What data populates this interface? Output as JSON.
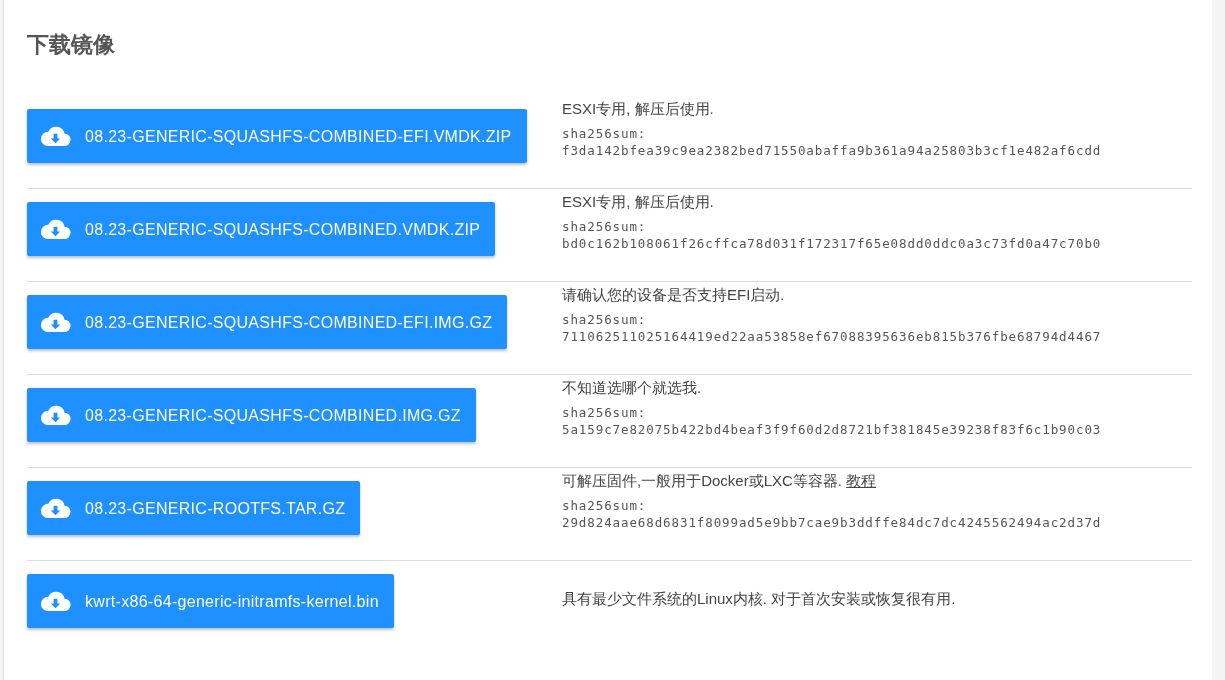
{
  "title": "下载镜像",
  "downloads": [
    {
      "file": "08.23-GENERIC-SQUASHFS-COMBINED-EFI.VMDK.ZIP",
      "description": "ESXI专用, 解压后使用.",
      "sha_label": "sha256sum:",
      "sha": "f3da142bfea39c9ea2382bed71550abaffa9b361a94a25803b3cf1e482af6cdd"
    },
    {
      "file": "08.23-GENERIC-SQUASHFS-COMBINED.VMDK.ZIP",
      "description": "ESXI专用, 解压后使用.",
      "sha_label": "sha256sum:",
      "sha": "bd0c162b108061f26cffca78d031f172317f65e08dd0ddc0a3c73fd0a47c70b0"
    },
    {
      "file": "08.23-GENERIC-SQUASHFS-COMBINED-EFI.IMG.GZ",
      "description": "请确认您的设备是否支持EFI启动.",
      "sha_label": "sha256sum:",
      "sha": "711062511025164419ed22aa53858ef67088395636eb815b376fbe68794d4467"
    },
    {
      "file": "08.23-GENERIC-SQUASHFS-COMBINED.IMG.GZ",
      "description": "不知道选哪个就选我.",
      "sha_label": "sha256sum:",
      "sha": "5a159c7e82075b422bd4beaf3f9f60d2d8721bf381845e39238f83f6c1b90c03"
    },
    {
      "file": "08.23-GENERIC-ROOTFS.TAR.GZ",
      "description": "可解压固件,一般用于Docker或LXC等容器.",
      "link": "教程",
      "sha_label": "sha256sum:",
      "sha": "29d824aae68d6831f8099ad5e9bb7cae9b3ddffe84dc7dc4245562494ac2d37d"
    },
    {
      "file": "kwrt-x86-64-generic-initramfs-kernel.bin",
      "description": "具有最少文件系统的Linux内核. 对于首次安装或恢复很有用."
    }
  ]
}
